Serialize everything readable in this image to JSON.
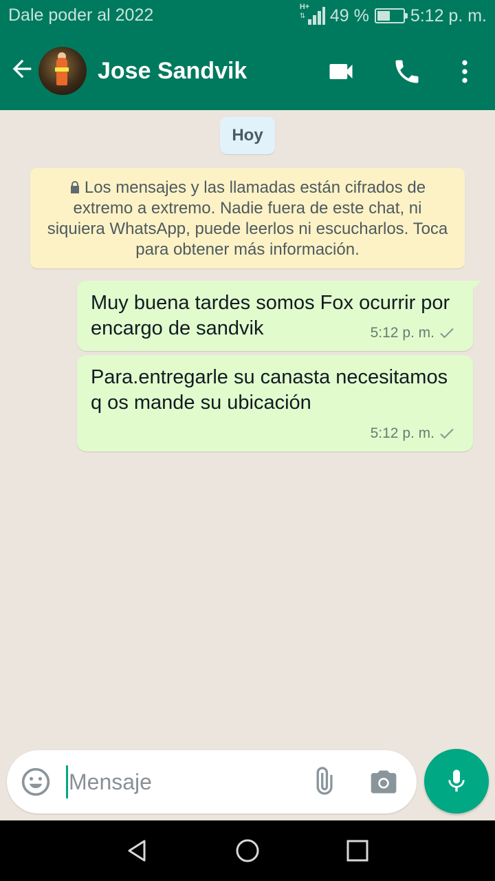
{
  "status_bar": {
    "carrier_text": "Dale poder al 2022",
    "network_type": "H+",
    "battery_percent": "49 %",
    "battery_level": 0.49,
    "time": "5:12 p. m."
  },
  "header": {
    "contact_name": "Jose Sandvik",
    "icons": {
      "back": "arrow-left-icon",
      "video": "video-call-icon",
      "call": "phone-icon",
      "menu": "more-vert-icon"
    }
  },
  "chat": {
    "day_label": "Hoy",
    "encryption_notice": "Los mensajes y las llamadas están cifrados de extremo a extremo. Nadie fuera de este chat, ni siquiera WhatsApp, puede leerlos ni escucharlos. Toca para obtener más información.",
    "messages": [
      {
        "text": "Muy buena tardes somos Fox ocurrir por encargo de sandvik",
        "time": "5:12 p. m.",
        "status": "sent"
      },
      {
        "text": "Para.entregarle su canasta necesitamos q os mande su ubicación",
        "time": "5:12 p. m.",
        "status": "sent"
      }
    ]
  },
  "composer": {
    "placeholder": "Mensaje",
    "value": "",
    "icons": {
      "emoji": "emoji-icon",
      "attach": "paperclip-icon",
      "camera": "camera-icon",
      "mic": "mic-icon"
    }
  },
  "nav_bar": {
    "icons": [
      "back-triangle-icon",
      "home-circle-icon",
      "recents-square-icon"
    ]
  },
  "colors": {
    "header": "#007a5e",
    "accent": "#00a884",
    "outgoing_bubble": "#e1fbcd",
    "notice_bg": "#fdf2c6",
    "chat_bg": "#ece5dd"
  }
}
